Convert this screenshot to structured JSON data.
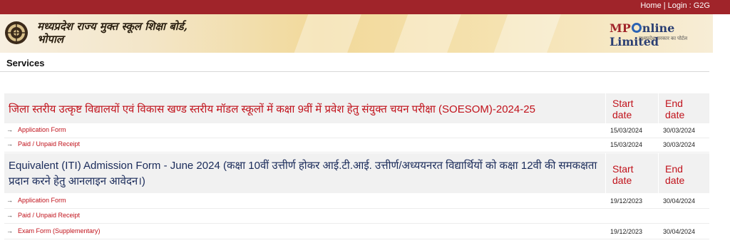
{
  "topbar": {
    "home": "Home",
    "separator": "|",
    "login": "Login : G2G"
  },
  "banner": {
    "board_name_line1": "मध्यप्रदेश राज्य मुक्त स्कूल शिक्षा बोर्ड,",
    "board_name_line2": "भोपाल",
    "brand_mp": "MP",
    "brand_rest": "nline Limited",
    "brand_tagline": "मध्यप्रदेश सरकार का पोर्टल"
  },
  "services_title": "Services",
  "sections": [
    {
      "heading": "जिला स्तरीय उत्कृष्ट विद्यालयों एवं विकास खण्ड स्तरीय मॉडल स्कूलों में कक्षा 9वीं में प्रवेश हेतु संयुक्त चयन परीक्षा (SOESOM)-2024-25",
      "start_label": "Start date",
      "end_label": "End date",
      "rows": [
        {
          "arrow": "→",
          "label": "Application Form",
          "start": "15/03/2024",
          "end": "30/03/2024"
        },
        {
          "arrow": "→",
          "label": "Paid / Unpaid Receipt",
          "start": "15/03/2024",
          "end": "30/03/2024"
        }
      ]
    },
    {
      "heading_line1": "Equivalent (ITI) Admission Form - June 2024 (कक्षा 10वीं उत्तीर्ण होकर आई.टी.आई. उत्तीर्ण/अध्ययनरत विद्यार्थियों को कक्षा 12वी की समकक्षता",
      "heading_line2": "प्रदान करने हेतु आनलाइन आवेदन।)",
      "start_label": "Start date",
      "end_label": "End date",
      "rows": [
        {
          "arrow": "→",
          "label": "Application Form",
          "start": "19/12/2023",
          "end": "30/04/2024"
        },
        {
          "arrow": "→",
          "label": "Paid / Unpaid Receipt",
          "start": "",
          "end": ""
        },
        {
          "arrow": "→",
          "label": "Exam Form (Supplementary)",
          "start": "19/12/2023",
          "end": "30/04/2024"
        }
      ]
    }
  ],
  "colors": {
    "topbar": "#a0242a",
    "link": "#c1121b",
    "heading_dark": "#1a2b5a",
    "section_bg": "#f1f1f1"
  }
}
